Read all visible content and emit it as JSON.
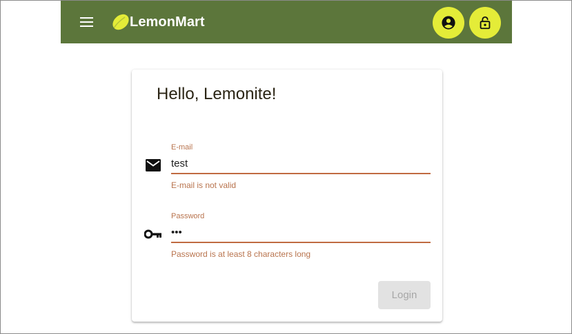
{
  "toolbar": {
    "app_name": "LemonMart",
    "menu_icon": "menu-icon",
    "logo_icon": "lemon-logo-icon",
    "account_icon": "account-circle-icon",
    "lock_icon": "lock-open-icon",
    "colors": {
      "background": "#5c763b",
      "button_background": "#e4ec38",
      "logo": "#e4ec38"
    }
  },
  "login": {
    "title": "Hello, Lemonite!",
    "email": {
      "label": "E-mail",
      "value": "test",
      "error": "E-mail is not valid",
      "icon": "email-icon"
    },
    "password": {
      "label": "Password",
      "value": "•••",
      "error": "Password is at least 8 characters long",
      "icon": "vpn-key-icon"
    },
    "submit_label": "Login",
    "colors": {
      "error": "#b8734d",
      "underline": "#c06a41",
      "disabled_button": "#e2e2e2"
    }
  }
}
